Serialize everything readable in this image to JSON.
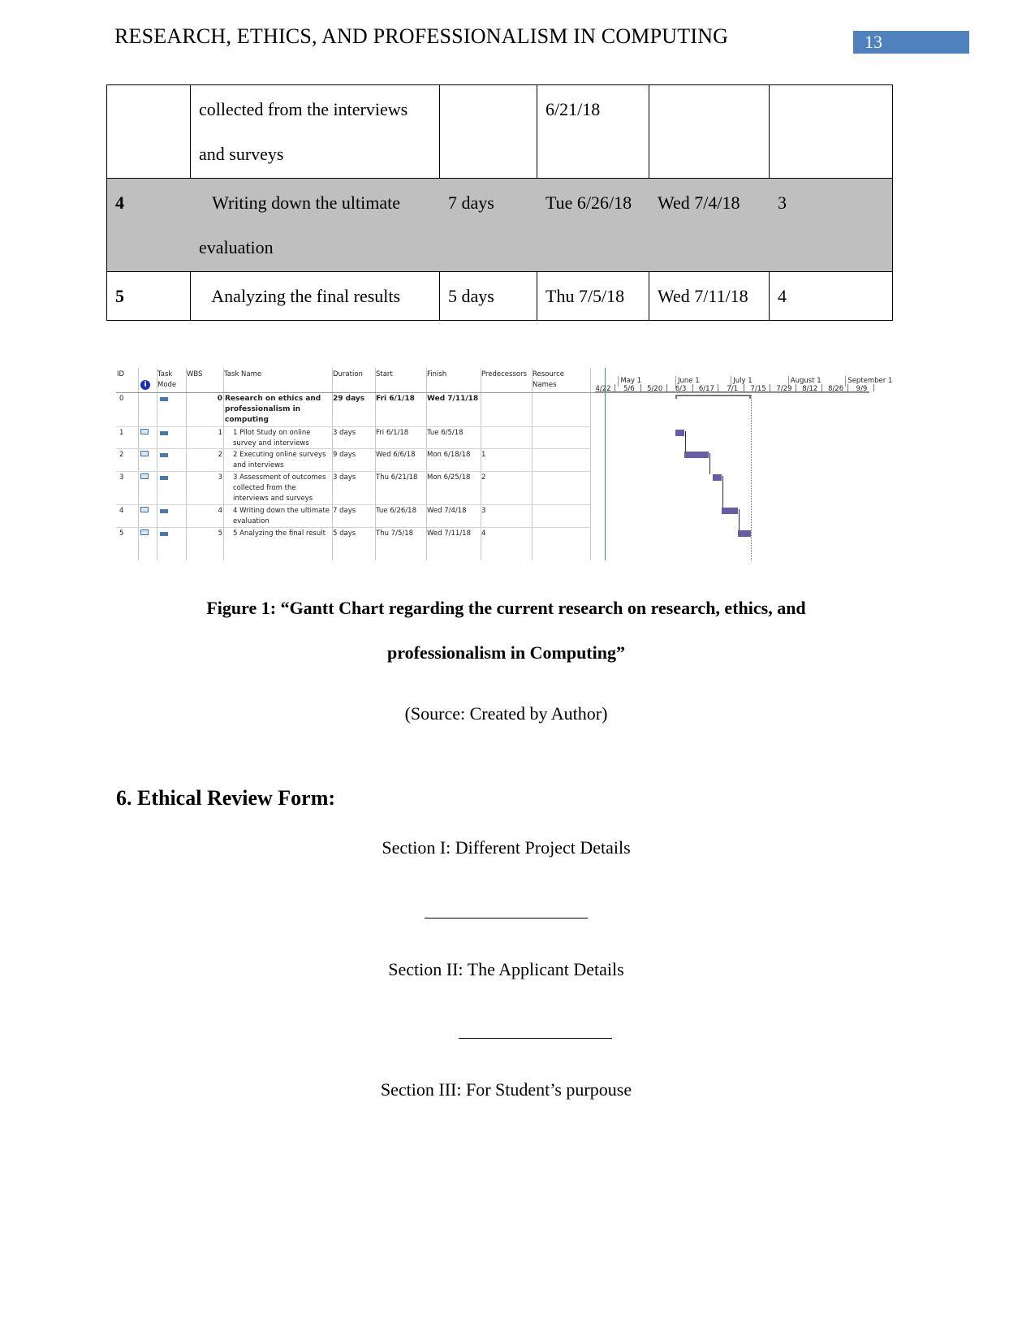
{
  "header": {
    "title": "RESEARCH, ETHICS, AND PROFESSIONALISM IN COMPUTING",
    "page_number": "13",
    "accent": "#4f81bd"
  },
  "table": {
    "rows": [
      {
        "id": "",
        "task": [
          "collected from the interviews",
          "and surveys"
        ],
        "duration": "",
        "start": "6/21/18",
        "finish": "",
        "pred": "",
        "shaded": false
      },
      {
        "id": "4",
        "task": [
          "   Writing down the ultimate",
          "evaluation"
        ],
        "duration": "7 days",
        "start": "Tue 6/26/18",
        "finish": "Wed 7/4/18",
        "pred": "3",
        "shaded": true
      },
      {
        "id": "5",
        "task": [
          "   Analyzing the final results"
        ],
        "duration": "5 days",
        "start": "Thu 7/5/18",
        "finish": "Wed 7/11/18",
        "pred": "4",
        "shaded": false
      }
    ],
    "shade_color": "#bfbfbf"
  },
  "gantt": {
    "columns": {
      "id": "ID",
      "mode": "Task Mode",
      "wbs": "WBS",
      "name": "Task Name",
      "duration": "Duration",
      "start": "Start",
      "finish": "Finish",
      "pred": "Predecessors",
      "resource": "Resource Names"
    },
    "months": [
      "May 1",
      "June 1",
      "July 1",
      "August 1",
      "September 1"
    ],
    "weeks": [
      "4/22",
      "5/6",
      "5/20",
      "6/3",
      "6/17",
      "7/1",
      "7/15",
      "7/29",
      "8/12",
      "8/26",
      "9/9"
    ],
    "tasks": [
      {
        "id": "0",
        "wbs": "0",
        "name": "Research on ethics and professionalism in computing",
        "duration": "29 days",
        "start": "Fri 6/1/18",
        "finish": "Wed 7/11/18",
        "pred": "",
        "summary": true
      },
      {
        "id": "1",
        "wbs": "1",
        "name": "1 Pilot Study on online survey and interviews",
        "duration": "3 days",
        "start": "Fri 6/1/18",
        "finish": "Tue 6/5/18",
        "pred": ""
      },
      {
        "id": "2",
        "wbs": "2",
        "name": "2 Executing online surveys and interviews",
        "duration": "9 days",
        "start": "Wed 6/6/18",
        "finish": "Mon 6/18/18",
        "pred": "1"
      },
      {
        "id": "3",
        "wbs": "3",
        "name": "3 Assessment of outcomes collected from the interviews and surveys",
        "duration": "3 days",
        "start": "Thu 6/21/18",
        "finish": "Mon 6/25/18",
        "pred": "2"
      },
      {
        "id": "4",
        "wbs": "4",
        "name": "4 Writing down the ultimate evaluation",
        "duration": "7 days",
        "start": "Tue 6/26/18",
        "finish": "Wed 7/4/18",
        "pred": "3"
      },
      {
        "id": "5",
        "wbs": "5",
        "name": "5 Analyzing the final result",
        "duration": "5 days",
        "start": "Thu 7/5/18",
        "finish": "Wed 7/11/18",
        "pred": "4"
      }
    ],
    "bar_color": "#6a5ba8"
  },
  "figure": {
    "caption_line1": "Figure 1: “Gantt Chart regarding the current research on research, ethics, and",
    "caption_line2": "professionalism in Computing”",
    "source": "(Source: Created by Author)"
  },
  "section": {
    "heading": "6. Ethical Review Form:",
    "items": [
      "Section I: Different Project Details",
      "Section II: The Applicant Details",
      "Section III: For Student’s purpouse"
    ]
  }
}
